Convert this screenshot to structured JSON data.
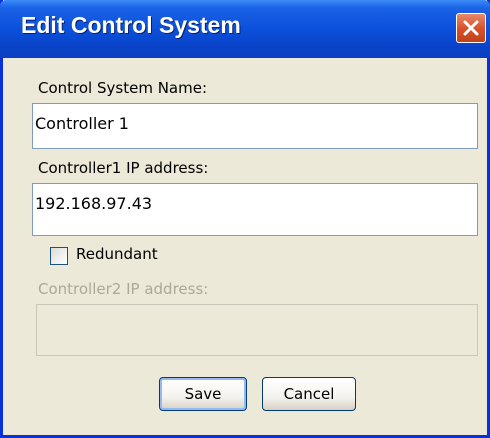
{
  "dialog": {
    "title": "Edit Control System",
    "close_label": "×"
  },
  "form": {
    "name_label": "Control System Name:",
    "name_value": "Controller 1",
    "ip1_label": "Controller1 IP address:",
    "ip1_value": "192.168.97.43",
    "redundant_label": "Redundant",
    "redundant_checked": false,
    "ip2_label": "Controller2 IP address:",
    "ip2_value": ""
  },
  "buttons": {
    "save_label": "Save",
    "cancel_label": "Cancel"
  },
  "colors": {
    "titlebar": "#0a4ed9",
    "dialog_bg": "#ece9d8",
    "close_button": "#d9532b",
    "disabled_text": "#aca899"
  },
  "icons": {
    "close": "close-icon"
  }
}
